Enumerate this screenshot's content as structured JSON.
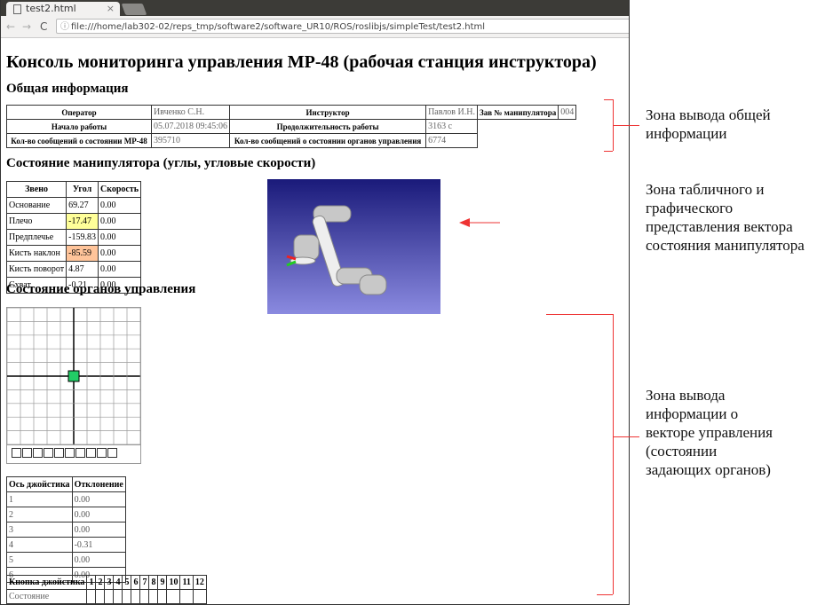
{
  "browser": {
    "tab_title": "test2.html",
    "url": "file:///home/lab302-02/reps_tmp/software2/software_UR10/ROS/roslibjs/simpleTest/test2.html"
  },
  "page": {
    "title": "Консоль мониторинга управления МР-48 (рабочая станция инструктора)"
  },
  "general": {
    "heading": "Общая информация",
    "operator_label": "Оператор",
    "operator": "Ивченко С.Н.",
    "instructor_label": "Инструктор",
    "instructor": "Павлов И.Н.",
    "serial_label": "Зав № манипулятора",
    "serial": "004",
    "start_label": "Начало работы",
    "start": "05.07.2018 09:45:06",
    "duration_label": "Продолжительность работы",
    "duration": "3163 с",
    "msg_mr_label": "Кол-во сообщений о состоянии МР-48",
    "msg_mr": "395710",
    "msg_ctrl_label": "Кол-во сообщений о состоянии органов управления",
    "msg_ctrl": "6774"
  },
  "manipulator": {
    "heading": "Состояние манипулятора (углы, угловые скорости)",
    "headers": [
      "Звено",
      "Угол",
      "Скорость"
    ],
    "rows": [
      {
        "name": "Основание",
        "angle": "69.27",
        "speed": "0.00"
      },
      {
        "name": "Плечо",
        "angle": "-17.47",
        "speed": "0.00",
        "highlight": "#ffff99"
      },
      {
        "name": "Предплечье",
        "angle": "-159.83",
        "speed": "0.00"
      },
      {
        "name": "Кисть наклон",
        "angle": "-85.59",
        "speed": "0.00",
        "highlight": "#ffc49a"
      },
      {
        "name": "Кисть поворот",
        "angle": "4.87",
        "speed": "0.00"
      },
      {
        "name": "Схват",
        "angle": "-0.21",
        "speed": "0.00"
      }
    ]
  },
  "controls": {
    "heading": "Состояние органов управления",
    "axes_headers": [
      "Ось джойстика",
      "Отклонение"
    ],
    "axes": [
      {
        "n": "1",
        "v": "0.00"
      },
      {
        "n": "2",
        "v": "0.00"
      },
      {
        "n": "3",
        "v": "0.00"
      },
      {
        "n": "4",
        "v": "-0.31"
      },
      {
        "n": "5",
        "v": "0.00"
      },
      {
        "n": "6",
        "v": "0.00"
      }
    ],
    "buttons_label": "Кнопка джойстика",
    "buttons": [
      "1",
      "2",
      "3",
      "4",
      "5",
      "6",
      "7",
      "8",
      "9",
      "10",
      "11",
      "12"
    ],
    "state_label": "Состояние",
    "cursor_color": "#22cc66"
  },
  "annotations": [
    "Зона вывода общей информации",
    "Зона табличного и графического представления вектора состояния манипулятора",
    "Зона вывода информации о векторе управления (состоянии задающих органов)"
  ],
  "annotation_lines": [
    [
      "Зона вывода общей",
      "информации"
    ],
    [
      "Зона табличного и",
      "графического",
      "представления вектора",
      "состояния манипулятора"
    ],
    [
      "Зона вывода",
      "информации о",
      "векторе управления",
      "(состоянии",
      "задающих органов)"
    ]
  ]
}
